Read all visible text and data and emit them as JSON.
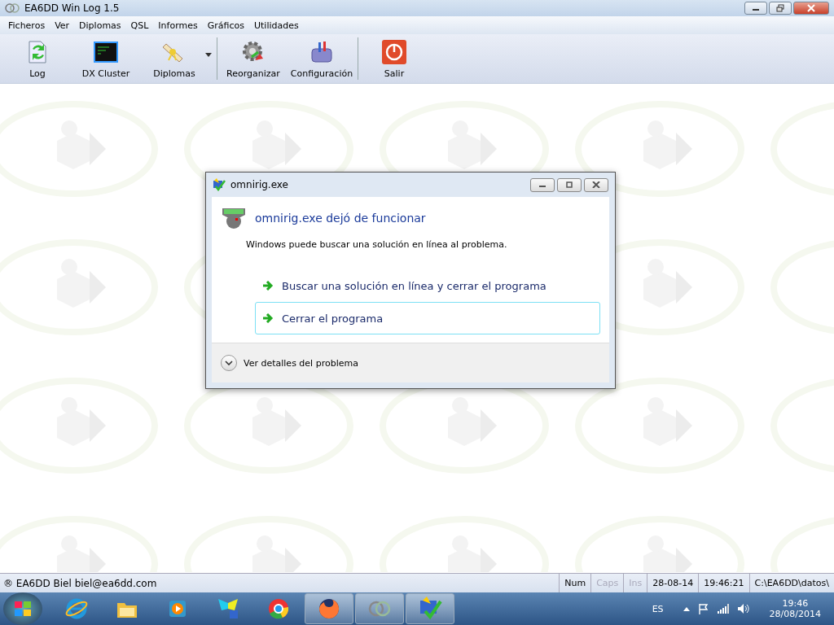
{
  "window": {
    "title": "EA6DD Win Log 1.5"
  },
  "menu": [
    "Ficheros",
    "Ver",
    "Diplomas",
    "QSL",
    "Informes",
    "Gráficos",
    "Utilidades"
  ],
  "toolbar": [
    [
      {
        "label": "Log",
        "kind": "log",
        "dropdown": false
      },
      {
        "label": "DX Cluster",
        "kind": "cluster",
        "dropdown": false
      },
      {
        "label": "Diplomas",
        "kind": "diploma",
        "dropdown": true
      }
    ],
    [
      {
        "label": "Reorganizar",
        "kind": "gear",
        "dropdown": false
      },
      {
        "label": "Configuración",
        "kind": "toolbox",
        "dropdown": false
      }
    ],
    [
      {
        "label": "Salir",
        "kind": "power",
        "dropdown": false
      }
    ]
  ],
  "dialog": {
    "title": "omnirig.exe",
    "heading": "omnirig.exe dejó de funcionar",
    "message": "Windows puede buscar una solución en línea al problema.",
    "options": [
      {
        "label": "Buscar una solución en línea y cerrar el programa",
        "focused": false
      },
      {
        "label": "Cerrar el programa",
        "focused": true
      }
    ],
    "details": "Ver detalles del problema"
  },
  "status_bar": {
    "text": "® EA6DD Biel biel@ea6dd.com",
    "panes": [
      {
        "label": "Num",
        "disabled": false
      },
      {
        "label": "Caps",
        "disabled": true
      },
      {
        "label": "Ins",
        "disabled": true
      },
      {
        "label": "28-08-14",
        "disabled": false
      },
      {
        "label": "19:46:21",
        "disabled": false
      },
      {
        "label": "C:\\EA6DD\\datos\\",
        "disabled": false
      }
    ]
  },
  "taskbar": {
    "apps": [
      {
        "kind": "ie",
        "running": false
      },
      {
        "kind": "folder",
        "running": false
      },
      {
        "kind": "media",
        "running": false
      },
      {
        "kind": "butterfly",
        "running": false
      },
      {
        "kind": "chrome",
        "running": false
      },
      {
        "kind": "firefox",
        "running": true
      },
      {
        "kind": "rings",
        "running": true
      },
      {
        "kind": "check",
        "running": true
      }
    ],
    "language": "ES",
    "time": "19:46",
    "date": "28/08/2014"
  }
}
